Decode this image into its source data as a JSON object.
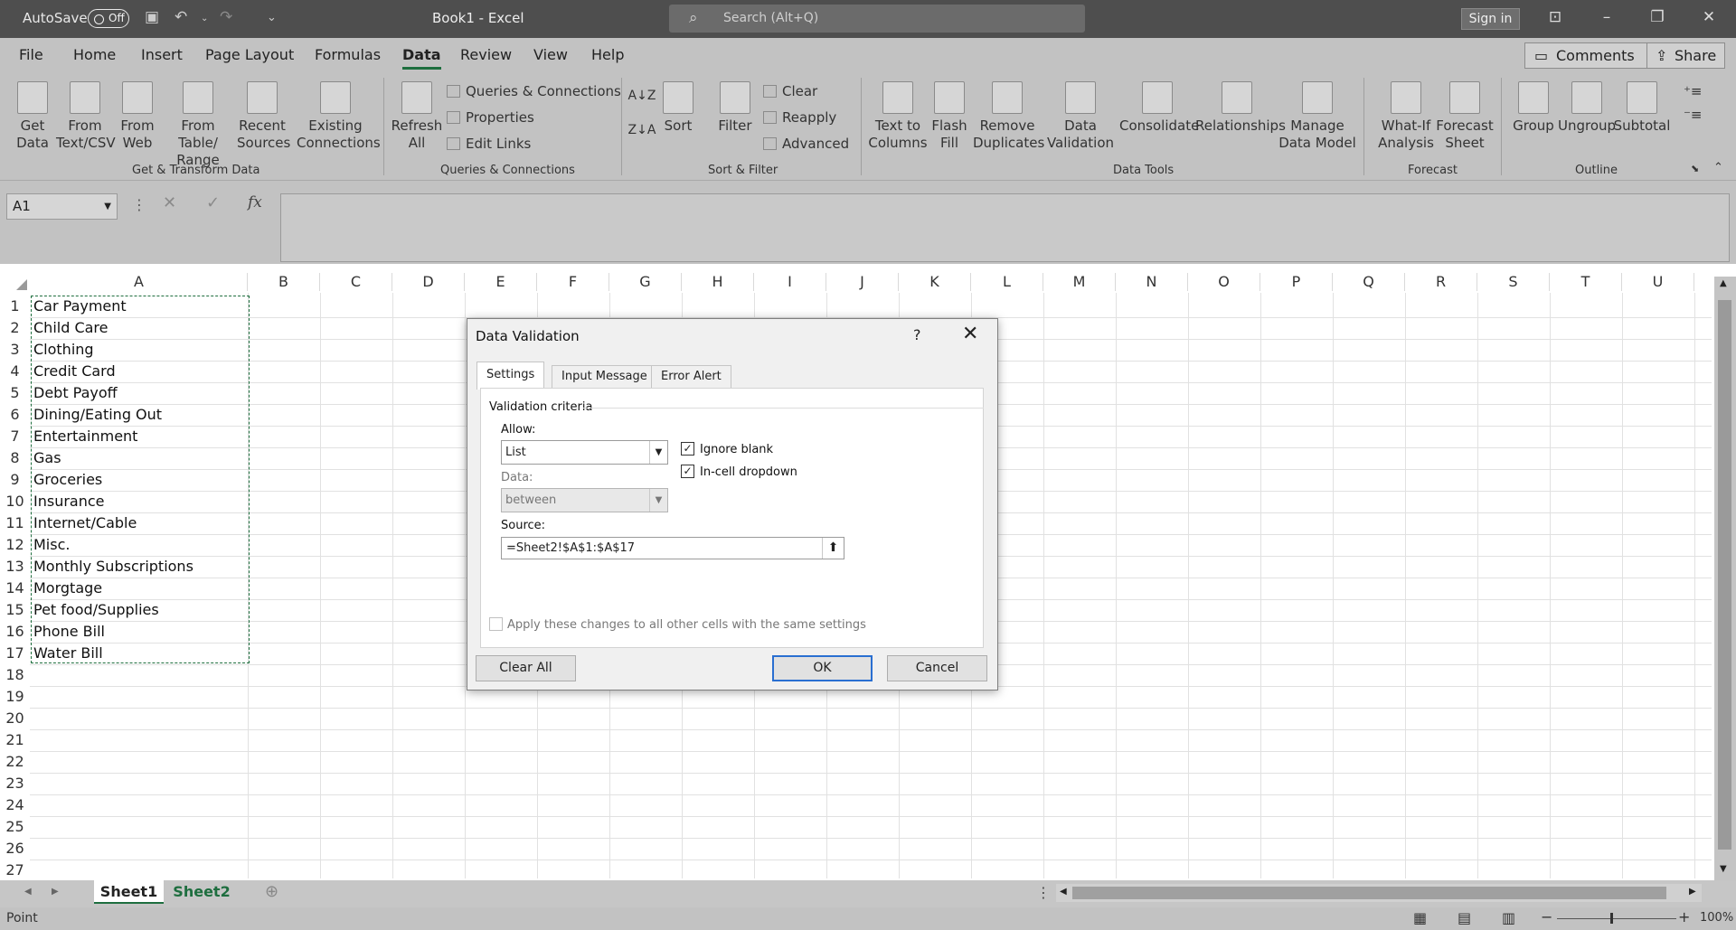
{
  "titlebar": {
    "autosave_label": "AutoSave",
    "toggle_label": "Off",
    "title": "Book1  -  Excel",
    "search_placeholder": "Search (Alt+Q)",
    "signin": "Sign in"
  },
  "tabs": [
    "File",
    "Home",
    "Insert",
    "Page Layout",
    "Formulas",
    "Data",
    "Review",
    "View",
    "Help"
  ],
  "active_tab": "Data",
  "comments": "Comments",
  "share": "Share",
  "ribbon": {
    "get_data": "Get Data",
    "from_text": "From Text/CSV",
    "from_web": "From Web",
    "from_table": "From Table/ Range",
    "recent": "Recent Sources",
    "existing": "Existing Connections",
    "refresh": "Refresh All",
    "queries": "Queries & Connections",
    "properties": "Properties",
    "edit_links": "Edit Links",
    "sort": "Sort",
    "filter": "Filter",
    "clear": "Clear",
    "reapply": "Reapply",
    "advanced": "Advanced",
    "text_to_columns": "Text to Columns",
    "flash_fill": "Flash Fill",
    "remove_dup": "Remove Duplicates",
    "data_validation": "Data Validation",
    "consolidate": "Consolidate",
    "relationships": "Relationships",
    "manage_model": "Manage Data Model",
    "whatif": "What-If Analysis",
    "forecast_sheet": "Forecast Sheet",
    "group": "Group",
    "ungroup": "Ungroup",
    "subtotal": "Subtotal",
    "groups": {
      "g1": "Get & Transform Data",
      "g2": "Queries & Connections",
      "g3": "Sort & Filter",
      "g4": "Data Tools",
      "g5": "Forecast",
      "g6": "Outline"
    }
  },
  "namebox": "A1",
  "columns": [
    "A",
    "B",
    "C",
    "D",
    "E",
    "F",
    "G",
    "H",
    "I",
    "J",
    "K",
    "L",
    "M",
    "N",
    "O",
    "P",
    "Q",
    "R",
    "S",
    "T",
    "U"
  ],
  "rows": [
    "1",
    "2",
    "3",
    "4",
    "5",
    "6",
    "7",
    "8",
    "9",
    "10",
    "11",
    "12",
    "13",
    "14",
    "15",
    "16",
    "17",
    "18",
    "19",
    "20",
    "21",
    "22",
    "23",
    "24",
    "25",
    "26",
    "27"
  ],
  "cells": [
    "Car Payment",
    "Child Care",
    "Clothing",
    "Credit Card",
    "Debt Payoff",
    "Dining/Eating Out",
    "Entertainment",
    "Gas",
    "Groceries",
    "Insurance",
    "Internet/Cable",
    "Misc.",
    "Monthly Subscriptions",
    "Morgtage",
    "Pet food/Supplies",
    "Phone Bill",
    "Water Bill"
  ],
  "sheets": [
    "Sheet1",
    "Sheet2"
  ],
  "status": "Point",
  "zoom": "100%",
  "dialog": {
    "title": "Data Validation",
    "help": "?",
    "close": "✕",
    "tabs": [
      "Settings",
      "Input Message",
      "Error Alert"
    ],
    "criteria": "Validation criteria",
    "allow_label": "Allow:",
    "allow_value": "List",
    "data_label": "Data:",
    "data_value": "between",
    "ignore_blank": "Ignore blank",
    "incell_dropdown": "In-cell dropdown",
    "source_label": "Source:",
    "source_value": "=Sheet2!$A$1:$A$17",
    "apply_all": "Apply these changes to all other cells with the same settings",
    "clear_all": "Clear All",
    "ok": "OK",
    "cancel": "Cancel"
  }
}
